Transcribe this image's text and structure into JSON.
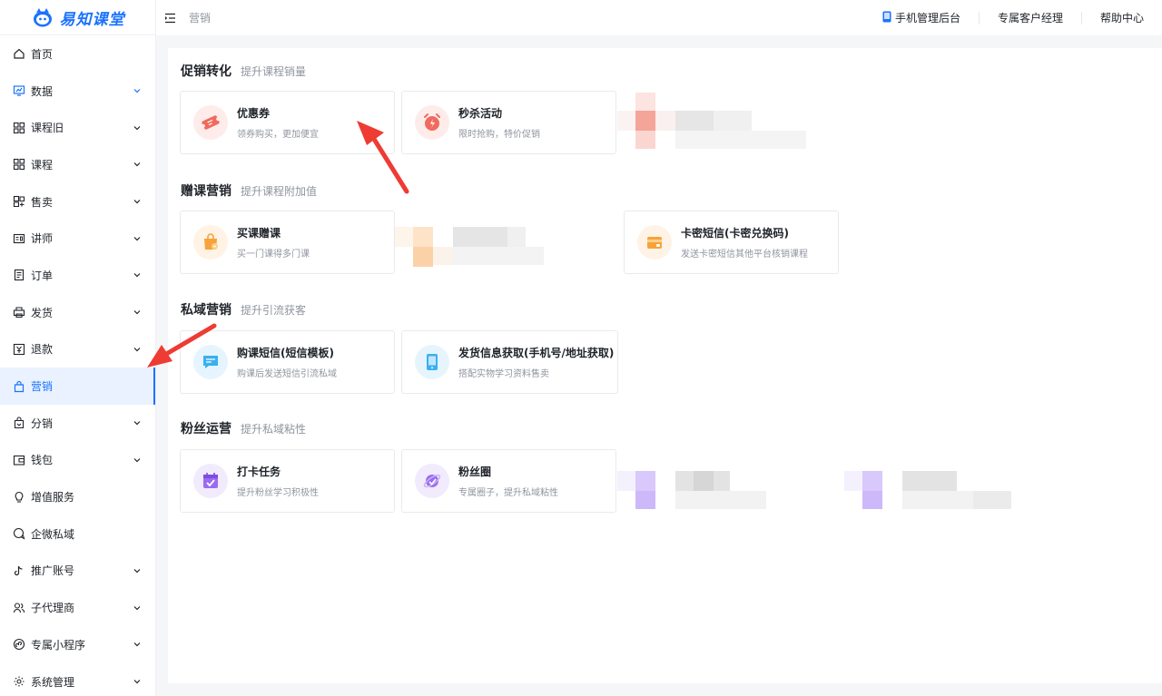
{
  "brand": {
    "name": "易知课堂"
  },
  "header": {
    "breadcrumb": "营销",
    "links": [
      {
        "label": "手机管理后台",
        "icon": "phone-icon"
      },
      {
        "label": "专属客户经理"
      },
      {
        "label": "帮助中心"
      }
    ]
  },
  "sidebar": {
    "items": [
      {
        "label": "首页",
        "icon": "home-icon",
        "chevron": false,
        "active": false
      },
      {
        "label": "数据",
        "icon": "chart-icon",
        "chevron": true,
        "active": false
      },
      {
        "label": "课程旧",
        "icon": "grid-icon",
        "chevron": true,
        "active": false
      },
      {
        "label": "课程",
        "icon": "grid-icon",
        "chevron": true,
        "active": false
      },
      {
        "label": "售卖",
        "icon": "tag-icon",
        "chevron": true,
        "active": false
      },
      {
        "label": "讲师",
        "icon": "id-card-icon",
        "chevron": true,
        "active": false
      },
      {
        "label": "订单",
        "icon": "order-icon",
        "chevron": true,
        "active": false
      },
      {
        "label": "发货",
        "icon": "printer-icon",
        "chevron": true,
        "active": false
      },
      {
        "label": "退款",
        "icon": "refund-icon",
        "chevron": true,
        "active": false
      },
      {
        "label": "营销",
        "icon": "bag-icon",
        "chevron": false,
        "active": true
      },
      {
        "label": "分销",
        "icon": "share-bag-icon",
        "chevron": true,
        "active": false
      },
      {
        "label": "钱包",
        "icon": "wallet-icon",
        "chevron": true,
        "active": false
      },
      {
        "label": "增值服务",
        "icon": "bulb-icon",
        "chevron": false,
        "active": false
      },
      {
        "label": "企微私域",
        "icon": "chat-icon",
        "chevron": false,
        "active": false
      },
      {
        "label": "推广账号",
        "icon": "tiktok-icon",
        "chevron": true,
        "active": false
      },
      {
        "label": "子代理商",
        "icon": "users-icon",
        "chevron": true,
        "active": false
      },
      {
        "label": "专属小程序",
        "icon": "miniapp-icon",
        "chevron": true,
        "active": false
      },
      {
        "label": "系统管理",
        "icon": "gear-icon",
        "chevron": true,
        "active": false
      }
    ]
  },
  "sections": [
    {
      "title": "促销转化",
      "subtitle": "提升课程销量",
      "cards": [
        {
          "title": "优惠券",
          "desc": "领券购买，更加便宜",
          "icon": "coupon-icon",
          "color": "#f06a5e",
          "bg": "#fdecea"
        },
        {
          "title": "秒杀活动",
          "desc": "限时抢购，特价促销",
          "icon": "alarm-clock-icon",
          "color": "#f06a5e",
          "bg": "#fdecea"
        }
      ]
    },
    {
      "title": "赠课营销",
      "subtitle": "提升课程附加值",
      "cards": [
        {
          "title": "买课赠课",
          "desc": "买一门课得多门课",
          "icon": "gift-bag-icon",
          "color": "#f7a23a",
          "bg": "#fef3e4"
        },
        {
          "title": "卡密短信(卡密兑换码)",
          "desc": "发送卡密短信其他平台核销课程",
          "icon": "card-wallet-icon",
          "color": "#f7a23a",
          "bg": "#fef3e4"
        }
      ]
    },
    {
      "title": "私域营销",
      "subtitle": "提升引流获客",
      "cards": [
        {
          "title": "购课短信(短信模板)",
          "desc": "购课后发送短信引流私域",
          "icon": "message-icon",
          "color": "#3ab0f0",
          "bg": "#e6f5fd"
        },
        {
          "title": "发货信息获取(手机号/地址获取)",
          "desc": "搭配实物学习资料售卖",
          "icon": "mobile-icon",
          "color": "#3ab0f0",
          "bg": "#e6f5fd"
        }
      ]
    },
    {
      "title": "粉丝运营",
      "subtitle": "提升私域粘性",
      "cards": [
        {
          "title": "打卡任务",
          "desc": "提升粉丝学习积极性",
          "icon": "calendar-check-icon",
          "color": "#9b6cf0",
          "bg": "#f1ebfd"
        },
        {
          "title": "粉丝圈",
          "desc": "专属圈子，提升私域粘性",
          "icon": "planet-icon",
          "color": "#9b6cf0",
          "bg": "#f1ebfd"
        }
      ]
    }
  ]
}
